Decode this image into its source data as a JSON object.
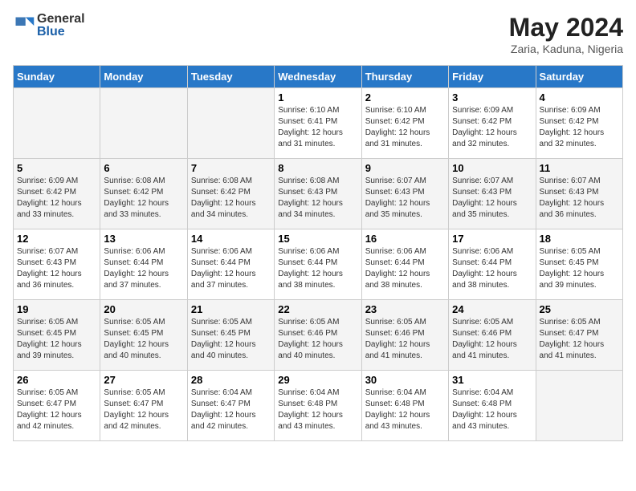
{
  "header": {
    "logo_general": "General",
    "logo_blue": "Blue",
    "title": "May 2024",
    "subtitle": "Zaria, Kaduna, Nigeria"
  },
  "days_of_week": [
    "Sunday",
    "Monday",
    "Tuesday",
    "Wednesday",
    "Thursday",
    "Friday",
    "Saturday"
  ],
  "weeks": [
    [
      {
        "day": "",
        "sunrise": "",
        "sunset": "",
        "daylight": ""
      },
      {
        "day": "",
        "sunrise": "",
        "sunset": "",
        "daylight": ""
      },
      {
        "day": "",
        "sunrise": "",
        "sunset": "",
        "daylight": ""
      },
      {
        "day": "1",
        "sunrise": "Sunrise: 6:10 AM",
        "sunset": "Sunset: 6:41 PM",
        "daylight": "Daylight: 12 hours and 31 minutes."
      },
      {
        "day": "2",
        "sunrise": "Sunrise: 6:10 AM",
        "sunset": "Sunset: 6:42 PM",
        "daylight": "Daylight: 12 hours and 31 minutes."
      },
      {
        "day": "3",
        "sunrise": "Sunrise: 6:09 AM",
        "sunset": "Sunset: 6:42 PM",
        "daylight": "Daylight: 12 hours and 32 minutes."
      },
      {
        "day": "4",
        "sunrise": "Sunrise: 6:09 AM",
        "sunset": "Sunset: 6:42 PM",
        "daylight": "Daylight: 12 hours and 32 minutes."
      }
    ],
    [
      {
        "day": "5",
        "sunrise": "Sunrise: 6:09 AM",
        "sunset": "Sunset: 6:42 PM",
        "daylight": "Daylight: 12 hours and 33 minutes."
      },
      {
        "day": "6",
        "sunrise": "Sunrise: 6:08 AM",
        "sunset": "Sunset: 6:42 PM",
        "daylight": "Daylight: 12 hours and 33 minutes."
      },
      {
        "day": "7",
        "sunrise": "Sunrise: 6:08 AM",
        "sunset": "Sunset: 6:42 PM",
        "daylight": "Daylight: 12 hours and 34 minutes."
      },
      {
        "day": "8",
        "sunrise": "Sunrise: 6:08 AM",
        "sunset": "Sunset: 6:43 PM",
        "daylight": "Daylight: 12 hours and 34 minutes."
      },
      {
        "day": "9",
        "sunrise": "Sunrise: 6:07 AM",
        "sunset": "Sunset: 6:43 PM",
        "daylight": "Daylight: 12 hours and 35 minutes."
      },
      {
        "day": "10",
        "sunrise": "Sunrise: 6:07 AM",
        "sunset": "Sunset: 6:43 PM",
        "daylight": "Daylight: 12 hours and 35 minutes."
      },
      {
        "day": "11",
        "sunrise": "Sunrise: 6:07 AM",
        "sunset": "Sunset: 6:43 PM",
        "daylight": "Daylight: 12 hours and 36 minutes."
      }
    ],
    [
      {
        "day": "12",
        "sunrise": "Sunrise: 6:07 AM",
        "sunset": "Sunset: 6:43 PM",
        "daylight": "Daylight: 12 hours and 36 minutes."
      },
      {
        "day": "13",
        "sunrise": "Sunrise: 6:06 AM",
        "sunset": "Sunset: 6:44 PM",
        "daylight": "Daylight: 12 hours and 37 minutes."
      },
      {
        "day": "14",
        "sunrise": "Sunrise: 6:06 AM",
        "sunset": "Sunset: 6:44 PM",
        "daylight": "Daylight: 12 hours and 37 minutes."
      },
      {
        "day": "15",
        "sunrise": "Sunrise: 6:06 AM",
        "sunset": "Sunset: 6:44 PM",
        "daylight": "Daylight: 12 hours and 38 minutes."
      },
      {
        "day": "16",
        "sunrise": "Sunrise: 6:06 AM",
        "sunset": "Sunset: 6:44 PM",
        "daylight": "Daylight: 12 hours and 38 minutes."
      },
      {
        "day": "17",
        "sunrise": "Sunrise: 6:06 AM",
        "sunset": "Sunset: 6:44 PM",
        "daylight": "Daylight: 12 hours and 38 minutes."
      },
      {
        "day": "18",
        "sunrise": "Sunrise: 6:05 AM",
        "sunset": "Sunset: 6:45 PM",
        "daylight": "Daylight: 12 hours and 39 minutes."
      }
    ],
    [
      {
        "day": "19",
        "sunrise": "Sunrise: 6:05 AM",
        "sunset": "Sunset: 6:45 PM",
        "daylight": "Daylight: 12 hours and 39 minutes."
      },
      {
        "day": "20",
        "sunrise": "Sunrise: 6:05 AM",
        "sunset": "Sunset: 6:45 PM",
        "daylight": "Daylight: 12 hours and 40 minutes."
      },
      {
        "day": "21",
        "sunrise": "Sunrise: 6:05 AM",
        "sunset": "Sunset: 6:45 PM",
        "daylight": "Daylight: 12 hours and 40 minutes."
      },
      {
        "day": "22",
        "sunrise": "Sunrise: 6:05 AM",
        "sunset": "Sunset: 6:46 PM",
        "daylight": "Daylight: 12 hours and 40 minutes."
      },
      {
        "day": "23",
        "sunrise": "Sunrise: 6:05 AM",
        "sunset": "Sunset: 6:46 PM",
        "daylight": "Daylight: 12 hours and 41 minutes."
      },
      {
        "day": "24",
        "sunrise": "Sunrise: 6:05 AM",
        "sunset": "Sunset: 6:46 PM",
        "daylight": "Daylight: 12 hours and 41 minutes."
      },
      {
        "day": "25",
        "sunrise": "Sunrise: 6:05 AM",
        "sunset": "Sunset: 6:47 PM",
        "daylight": "Daylight: 12 hours and 41 minutes."
      }
    ],
    [
      {
        "day": "26",
        "sunrise": "Sunrise: 6:05 AM",
        "sunset": "Sunset: 6:47 PM",
        "daylight": "Daylight: 12 hours and 42 minutes."
      },
      {
        "day": "27",
        "sunrise": "Sunrise: 6:05 AM",
        "sunset": "Sunset: 6:47 PM",
        "daylight": "Daylight: 12 hours and 42 minutes."
      },
      {
        "day": "28",
        "sunrise": "Sunrise: 6:04 AM",
        "sunset": "Sunset: 6:47 PM",
        "daylight": "Daylight: 12 hours and 42 minutes."
      },
      {
        "day": "29",
        "sunrise": "Sunrise: 6:04 AM",
        "sunset": "Sunset: 6:48 PM",
        "daylight": "Daylight: 12 hours and 43 minutes."
      },
      {
        "day": "30",
        "sunrise": "Sunrise: 6:04 AM",
        "sunset": "Sunset: 6:48 PM",
        "daylight": "Daylight: 12 hours and 43 minutes."
      },
      {
        "day": "31",
        "sunrise": "Sunrise: 6:04 AM",
        "sunset": "Sunset: 6:48 PM",
        "daylight": "Daylight: 12 hours and 43 minutes."
      },
      {
        "day": "",
        "sunrise": "",
        "sunset": "",
        "daylight": ""
      }
    ]
  ]
}
